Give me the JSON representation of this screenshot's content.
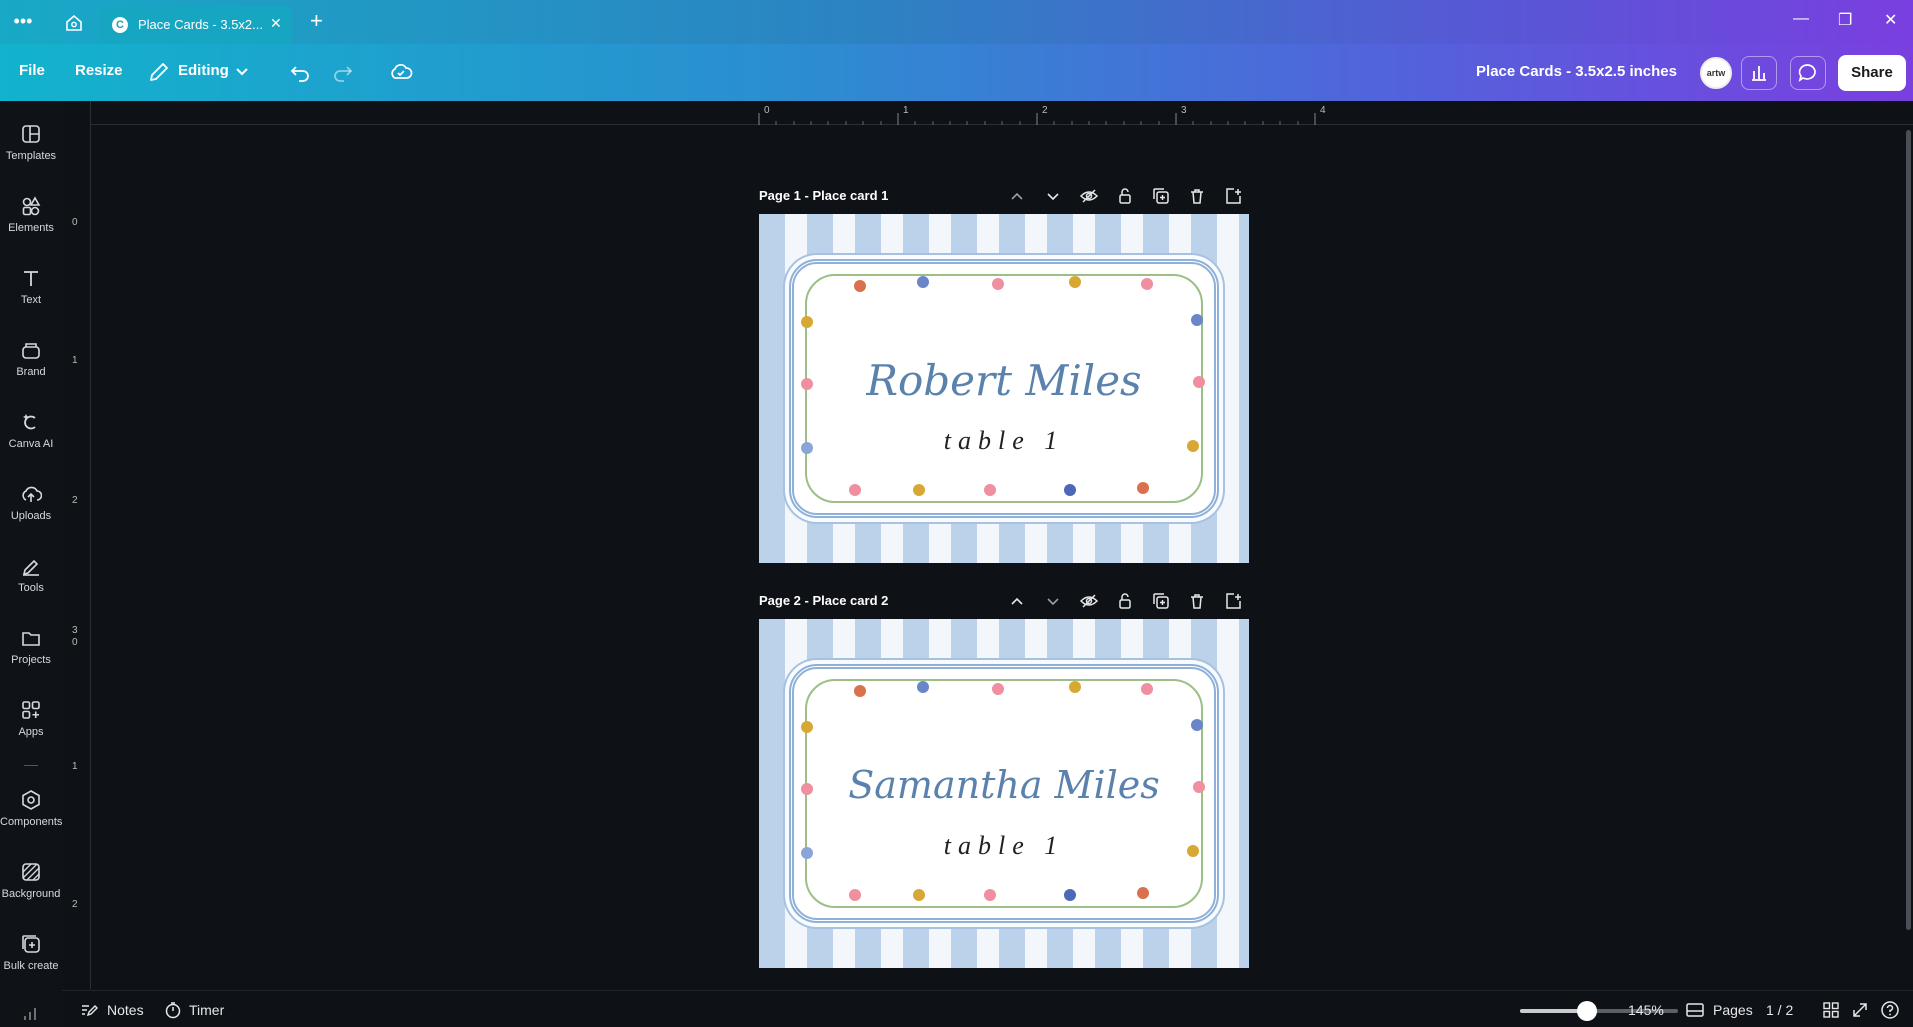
{
  "browser": {
    "tab": {
      "title": "Place Cards - 3.5x2...",
      "favicon": "C"
    },
    "new_tab": "+"
  },
  "toolbar": {
    "file": "File",
    "resize": "Resize",
    "editing": "Editing",
    "doc_title": "Place Cards - 3.5x2.5 inches",
    "avatar": "artw",
    "share": "Share"
  },
  "sidebar": {
    "items": [
      {
        "label": "Templates",
        "icon": "templates-icon"
      },
      {
        "label": "Elements",
        "icon": "elements-icon"
      },
      {
        "label": "Text",
        "icon": "text-icon"
      },
      {
        "label": "Brand",
        "icon": "brand-icon"
      },
      {
        "label": "Canva AI",
        "icon": "canva-ai-icon"
      },
      {
        "label": "Uploads",
        "icon": "uploads-icon"
      },
      {
        "label": "Tools",
        "icon": "tools-icon"
      },
      {
        "label": "Projects",
        "icon": "projects-icon"
      },
      {
        "label": "Apps",
        "icon": "apps-icon"
      },
      {
        "label": "Components",
        "icon": "components-icon"
      },
      {
        "label": "Background",
        "icon": "background-icon"
      },
      {
        "label": "Bulk create",
        "icon": "bulk-create-icon"
      }
    ]
  },
  "ruler": {
    "top": [
      "0",
      "1",
      "2",
      "3",
      "4"
    ],
    "left": [
      "0",
      "1",
      "2",
      "3",
      "0",
      "1",
      "2"
    ]
  },
  "pages": [
    {
      "title": "Page 1 - Place card 1",
      "name": "Robert Miles",
      "table": "table 1"
    },
    {
      "title": "Page 2 - Place card 2",
      "name": "Samantha Miles",
      "table": "table 1"
    }
  ],
  "bottom": {
    "notes": "Notes",
    "timer": "Timer",
    "zoom_percent": 145,
    "zoom": "145%",
    "pages": "Pages",
    "page_count": "1 / 2"
  },
  "colors": {
    "accent_gradient_start": "#12b3cc",
    "accent_gradient_end": "#7a3fe0",
    "canvas_bg": "#0e1116",
    "stripe_blue": "#bcd2ea",
    "name_blue": "#5a82ad"
  }
}
